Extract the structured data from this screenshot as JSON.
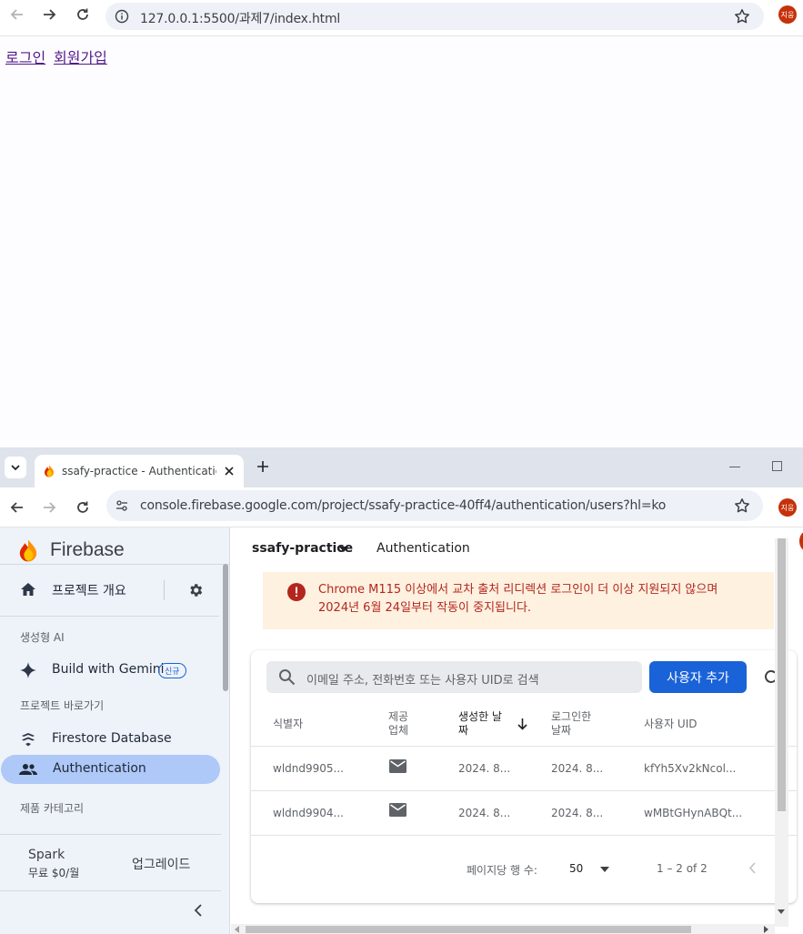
{
  "top_browser": {
    "url": "127.0.0.1:5500/과제7/index.html",
    "profile_initials": "지웅",
    "links": [
      "로그인",
      "회원가입"
    ]
  },
  "bottom_browser": {
    "tab_title": "ssafy-practice - Authentication",
    "url": "console.firebase.google.com/project/ssafy-practice-40ff4/authentication/users?hl=ko",
    "profile_initials": "지웅"
  },
  "firebase": {
    "brand": "Firebase",
    "project_name": "ssafy-practice",
    "page_title": "Authentication",
    "sidebar": {
      "overview": "프로젝트 개요",
      "genai_section": "생성형 AI",
      "gemini": "Build with Gemini",
      "gemini_badge": "신규",
      "shortcuts_section": "프로젝트 바로가기",
      "firestore": "Firestore Database",
      "authentication": "Authentication",
      "categories": "제품 카테고리",
      "plan_name": "Spark",
      "plan_price": "무료 $0/월",
      "upgrade": "업그레이드"
    },
    "banner": {
      "line1": "Chrome M115 이상에서 교차 출처 리디렉션 로그인이 더 이상 지원되지 않으며",
      "line2": "2024년 6월 24일부터 작동이 중지됩니다."
    },
    "search_placeholder": "이메일 주소, 전화번호 또는 사용자 UID로 검색",
    "add_user": "사용자 추가",
    "columns": {
      "identifier": "식별자",
      "provider_1": "제공",
      "provider_2": "업체",
      "created_1": "생성한 날",
      "created_2": "짜",
      "signin_1": "로그인한",
      "signin_2": "날짜",
      "uid": "사용자 UID"
    },
    "rows": [
      {
        "identifier": "wldnd9905...",
        "created": "2024. 8...",
        "signin": "2024. 8...",
        "uid": "kfYh5Xv2kNcol..."
      },
      {
        "identifier": "wldnd9904...",
        "created": "2024. 8...",
        "signin": "2024. 8...",
        "uid": "wMBtGHynABQt..."
      }
    ],
    "pagination": {
      "rows_per_page_label": "페이지당 행 수:",
      "rows_per_page": "50",
      "range": "1 – 2 of 2"
    }
  }
}
